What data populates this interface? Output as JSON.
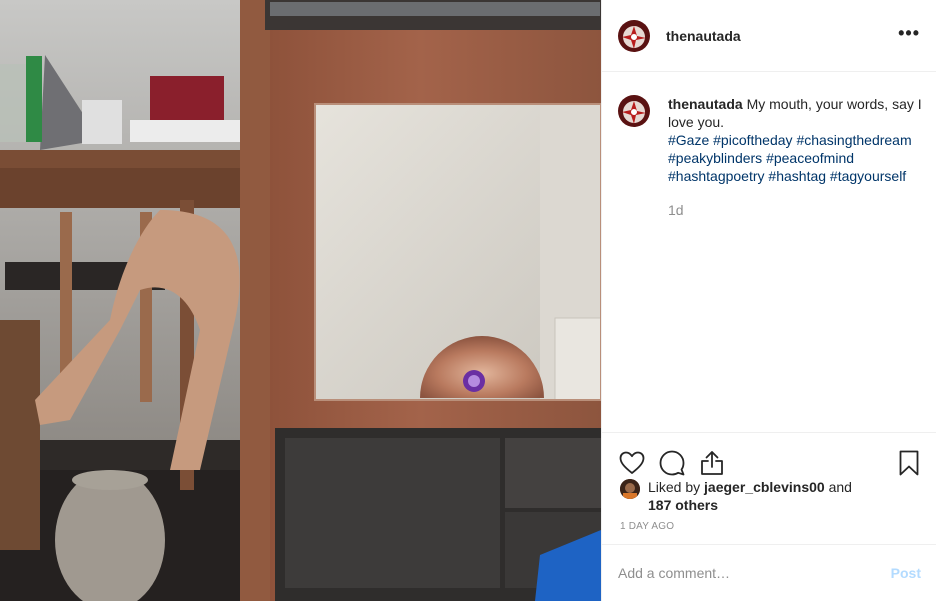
{
  "post": {
    "username": "thenautada",
    "caption_user": "thenautada",
    "caption_text": "My mouth, your words, say I love you.",
    "hashtags": [
      "#Gaze",
      "#picoftheday",
      "#chasingthedream",
      "#peakyblinders",
      "#peaceofmind",
      "#hashtagpoetry",
      "#hashtag",
      "#tagyourself"
    ],
    "caption_age": "1d",
    "more_glyph": "•••"
  },
  "likes": {
    "prefix": "Liked by",
    "user": "jaeger_cblevins00",
    "joiner": "and",
    "others": "187 others"
  },
  "timestamp": "1 DAY AGO",
  "comment": {
    "placeholder": "Add a comment…",
    "post_label": "Post"
  },
  "icons": {
    "like": "heart-icon",
    "comment": "comment-bubble-icon",
    "share": "share-icon",
    "save": "bookmark-icon"
  },
  "colors": {
    "hashtag": "#003569",
    "muted": "#8e8e8e",
    "post_disabled": "#b3dbff",
    "divider": "#efefef"
  }
}
